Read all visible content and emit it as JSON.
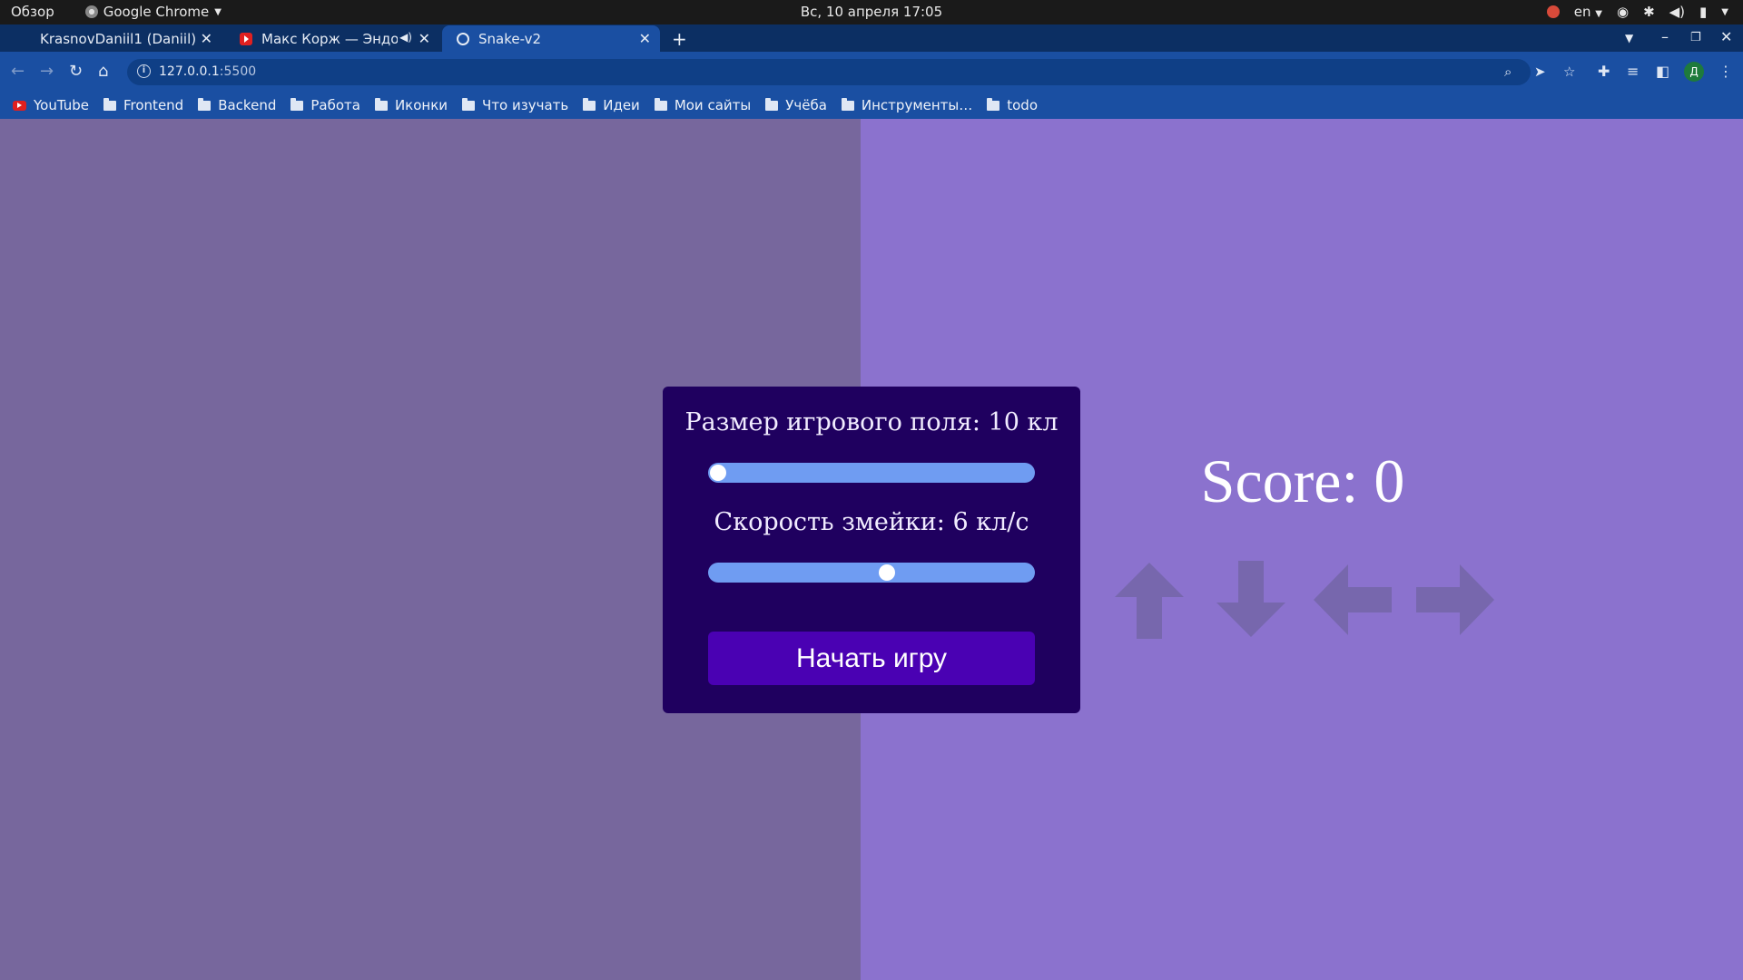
{
  "os_topbar": {
    "overview": "Обзор",
    "app_menu": "Google Chrome",
    "clock": "Вс, 10 апреля  17:05",
    "language": "en"
  },
  "tabs": [
    {
      "title": "KrasnovDaniil1 (Daniil)",
      "favicon": "github-icon",
      "active": false
    },
    {
      "title": "Макс Корж — Эндорф",
      "favicon": "youtube-icon",
      "active": false,
      "audio": true
    },
    {
      "title": "Snake-v2",
      "favicon": "globe-icon",
      "active": true
    }
  ],
  "address_bar": {
    "host": "127.0.0.1",
    "port": ":5500"
  },
  "bookmarks": [
    {
      "label": "YouTube",
      "icon": "youtube-icon"
    },
    {
      "label": "Frontend",
      "icon": "folder-icon"
    },
    {
      "label": "Backend",
      "icon": "folder-icon"
    },
    {
      "label": "Работа",
      "icon": "folder-icon"
    },
    {
      "label": "Иконки",
      "icon": "folder-icon"
    },
    {
      "label": "Что изучать",
      "icon": "folder-icon"
    },
    {
      "label": "Идеи",
      "icon": "folder-icon"
    },
    {
      "label": "Мои сайты",
      "icon": "folder-icon"
    },
    {
      "label": "Учёба",
      "icon": "folder-icon"
    },
    {
      "label": "Инструменты…",
      "icon": "folder-icon"
    },
    {
      "label": "todo",
      "icon": "folder-icon"
    }
  ],
  "profile_initial": "Д",
  "game": {
    "field_size_label": "Размер игрового поля: 10 кл",
    "field_size_slider_fraction": 0.0,
    "speed_label": "Скорость змейки: 6 кл/с",
    "speed_slider_fraction": 0.55,
    "start_button": "Начать игру",
    "score_text": "Score: 0",
    "controls": [
      "arrow-up-icon",
      "arrow-down-icon",
      "arrow-left-icon",
      "arrow-right-icon"
    ]
  },
  "colors": {
    "left_pane": "#77679d",
    "right_pane": "#8b72ce",
    "panel": "#1f005f",
    "slider_track": "#6f9cf2",
    "start_button": "#4a01b3",
    "arrow": "#7767ad"
  }
}
